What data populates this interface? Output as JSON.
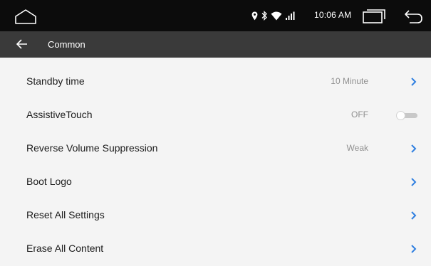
{
  "status_bar": {
    "time": "10:06 AM",
    "icons": [
      "home-icon",
      "location-icon",
      "bluetooth-icon",
      "wifi-icon",
      "signal-icon",
      "recents-icon",
      "back-icon"
    ]
  },
  "header": {
    "title": "Common",
    "back_icon": "arrow-left-icon"
  },
  "settings": [
    {
      "label": "Standby time",
      "value": "10 Minute",
      "control": "chevron"
    },
    {
      "label": "AssistiveTouch",
      "value": "OFF",
      "control": "toggle",
      "toggle_on": false
    },
    {
      "label": "Reverse Volume Suppression",
      "value": "Weak",
      "control": "chevron"
    },
    {
      "label": "Boot Logo",
      "value": "",
      "control": "chevron"
    },
    {
      "label": "Reset All Settings",
      "value": "",
      "control": "chevron"
    },
    {
      "label": "Erase All Content",
      "value": "",
      "control": "chevron"
    }
  ],
  "colors": {
    "status_bar_bg": "#0c0c0c",
    "title_bar_bg": "#3a3a3a",
    "list_bg": "#f4f4f4",
    "accent": "#2f7fe0"
  }
}
